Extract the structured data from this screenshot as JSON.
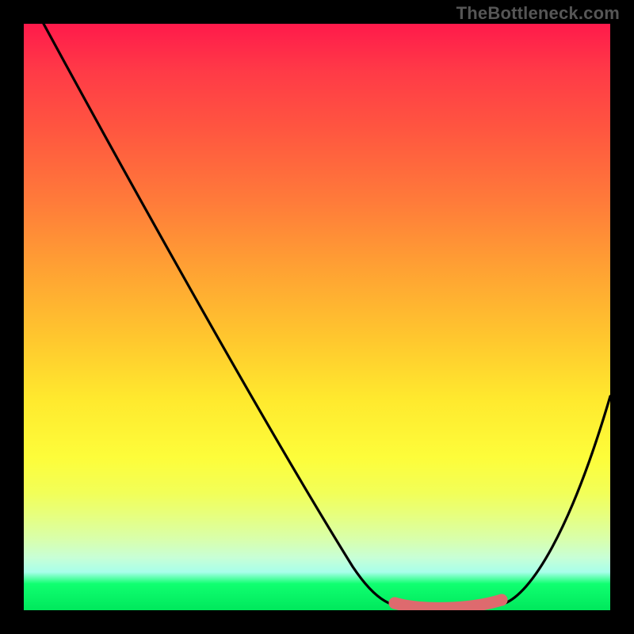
{
  "watermark": "TheBottleneck.com",
  "colors": {
    "background": "#000000",
    "gradient_top": "#ff1a4b",
    "gradient_bottom": "#00e85c",
    "curve": "#000000",
    "marker": "#de6a6e"
  },
  "chart_data": {
    "type": "line",
    "title": "",
    "xlabel": "",
    "ylabel": "",
    "xlim": [
      0,
      100
    ],
    "ylim": [
      0,
      100
    ],
    "series": [
      {
        "name": "bottleneck-curve",
        "x": [
          0,
          5,
          10,
          15,
          20,
          25,
          30,
          35,
          40,
          45,
          50,
          55,
          58,
          62,
          66,
          70,
          74,
          78,
          82,
          85,
          88,
          91,
          94,
          97,
          100
        ],
        "y": [
          100,
          92,
          84,
          76,
          68,
          60,
          52,
          44,
          36,
          28,
          20,
          12,
          7,
          3,
          1,
          0,
          0,
          0,
          1,
          3,
          7,
          12,
          19,
          27,
          36
        ]
      }
    ],
    "markers": {
      "name": "optimal-range",
      "x_start": 67,
      "x_end": 82,
      "y": 0
    }
  }
}
